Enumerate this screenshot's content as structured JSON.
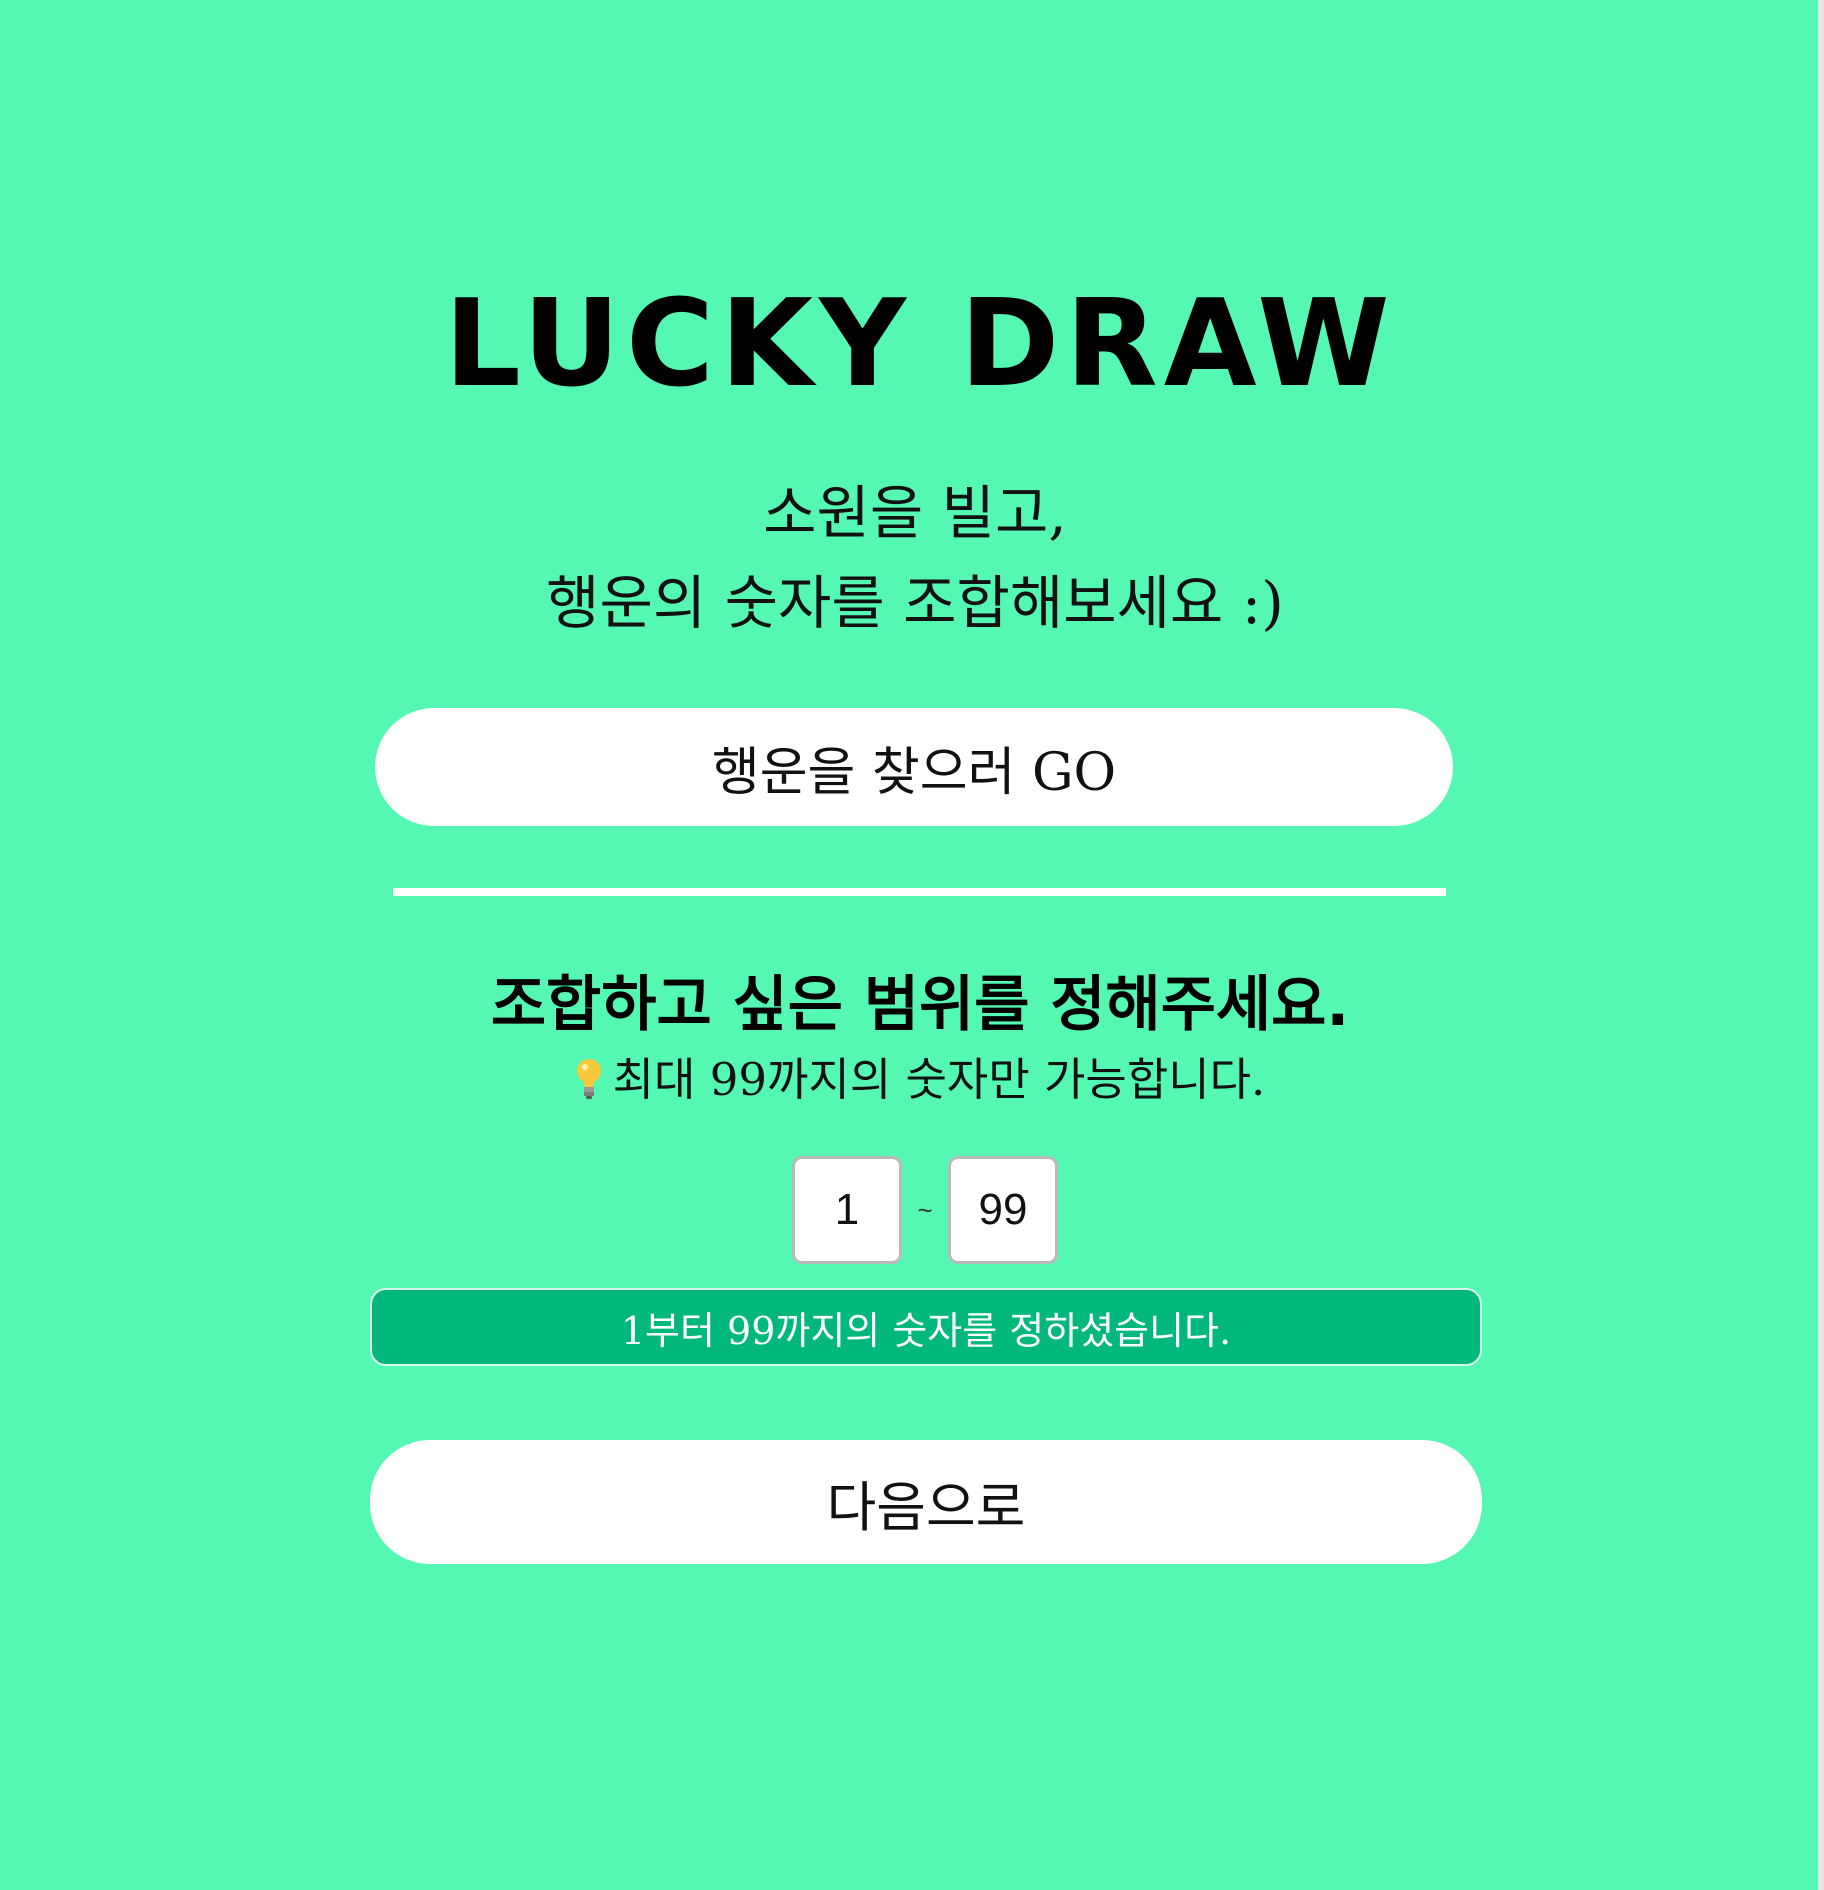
{
  "header": {
    "title": "LUCKY DRAW",
    "subtitle_line1": "소원을 빌고,",
    "subtitle_line2": "행운의 숫자를 조합해보세요 :)"
  },
  "go_button": {
    "label": "행운을 찾으러 GO"
  },
  "range_section": {
    "heading": "조합하고 싶은 범위를 정해주세요.",
    "hint_icon": "lightbulb-icon",
    "hint_text": "최대 99까지의 숫자만 가능합니다.",
    "min_value": "1",
    "separator": "~",
    "max_value": "99",
    "status_message": "1부터 99까지의 숫자를 정하셨습니다."
  },
  "next_button": {
    "label": "다음으로"
  },
  "colors": {
    "background": "#55F8B3",
    "status_bar": "#00B87B",
    "button": "#FFFFFF",
    "divider": "#FFFFFF"
  }
}
